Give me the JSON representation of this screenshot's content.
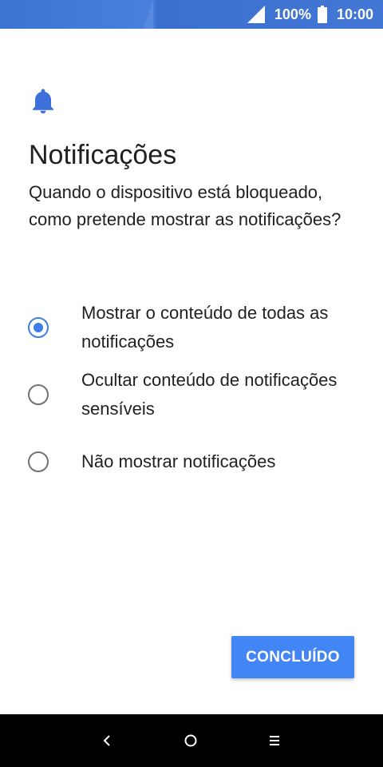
{
  "status_bar": {
    "battery_percent": "100%",
    "time": "10:00",
    "icons": [
      "signal-icon",
      "battery-icon"
    ]
  },
  "main": {
    "header_icon": "bell-icon",
    "title": "Notificações",
    "subtitle": "Quando o dispositivo está bloqueado, como pretende mostrar as notificações?",
    "options": [
      {
        "label": "Mostrar o conteúdo de todas as notificações",
        "selected": true
      },
      {
        "label": "Ocultar conteúdo de notificações sensíveis",
        "selected": false
      },
      {
        "label": "Não mostrar notificações",
        "selected": false
      }
    ],
    "done_label": "CONCLUÍDO"
  },
  "nav_bar": {
    "icons": [
      "back-icon",
      "home-icon",
      "menu-icon"
    ]
  },
  "colors": {
    "accent": "#4285f4",
    "radio_selected": "#3d7de6",
    "status_bar": "#4277d6",
    "nav_bar": "#000000"
  }
}
